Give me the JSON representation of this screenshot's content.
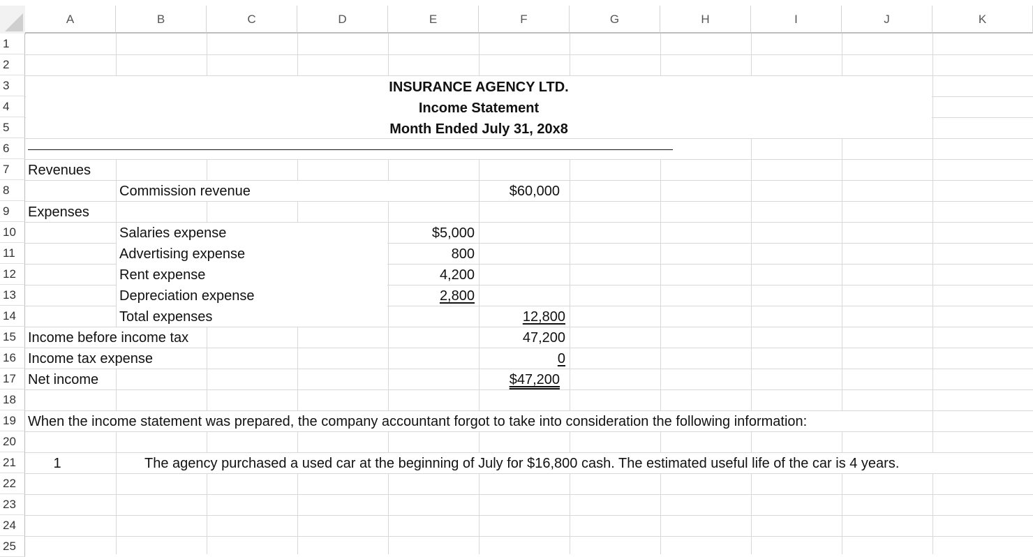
{
  "columns": [
    "A",
    "B",
    "C",
    "D",
    "E",
    "F",
    "G",
    "H",
    "I",
    "J",
    "K"
  ],
  "rows": [
    "1",
    "2",
    "3",
    "4",
    "5",
    "6",
    "7",
    "8",
    "9",
    "10",
    "11",
    "12",
    "13",
    "14",
    "15",
    "16",
    "17",
    "18",
    "19",
    "20",
    "21",
    "22",
    "23",
    "24",
    "25"
  ],
  "header": {
    "company": "INSURANCE AGENCY LTD.",
    "statement": "Income Statement",
    "period": "Month Ended July 31, 20x8"
  },
  "body": {
    "revenues_label": "Revenues",
    "commission_label": "Commission revenue",
    "commission_value": "$60,000",
    "expenses_label": "Expenses",
    "salaries_label": "Salaries expense",
    "salaries_value": "$5,000",
    "advertising_label": "Advertising expense",
    "advertising_value": "800",
    "rent_label": "Rent expense",
    "rent_value": "4,200",
    "depreciation_label": "Depreciation expense",
    "depreciation_value": "2,800",
    "total_expenses_label": "Total expenses",
    "total_expenses_value": "12,800",
    "income_before_tax_label": "Income before income tax",
    "income_before_tax_value": "47,200",
    "tax_label": "Income tax expense",
    "tax_value": "0",
    "net_income_label": "Net income",
    "net_income_value": "$47,200"
  },
  "note": {
    "intro": "When the income statement was prepared, the company accountant forgot to take into consideration the following information:",
    "item_number": "1",
    "item_text": "The agency purchased a used car at the beginning of July for $16,800 cash. The estimated useful life of the car is 4 years."
  }
}
